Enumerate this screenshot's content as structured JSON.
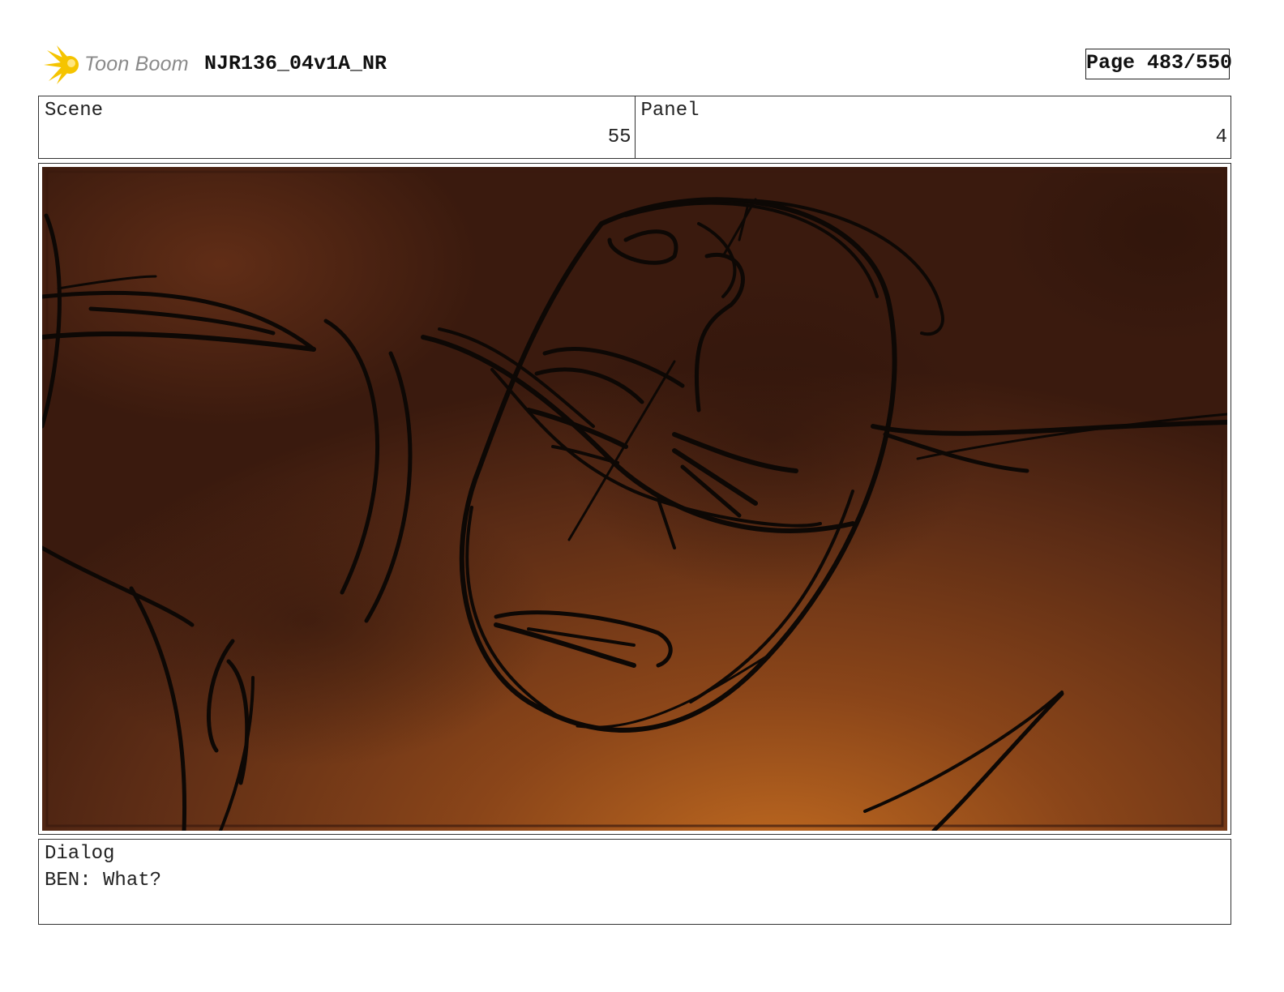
{
  "header": {
    "logo_text": "Toon Boom",
    "logo_icon": "starburst-logo-icon",
    "project_title": "NJR136_04v1A_NR",
    "page_indicator": "Page 483/550"
  },
  "info": {
    "scene_label": "Scene",
    "scene_value": "55",
    "panel_label": "Panel",
    "panel_value": "4"
  },
  "panel": {
    "image_description_icon": "rough-sketch-artwork",
    "colors": {
      "background_dark": "#3e1d10",
      "background_mid": "#6b3419",
      "background_glow": "#b8651f",
      "ink": "#0d0805",
      "logo_yellow": "#f5c400"
    }
  },
  "dialog": {
    "label": "Dialog",
    "text": "BEN: What?"
  }
}
